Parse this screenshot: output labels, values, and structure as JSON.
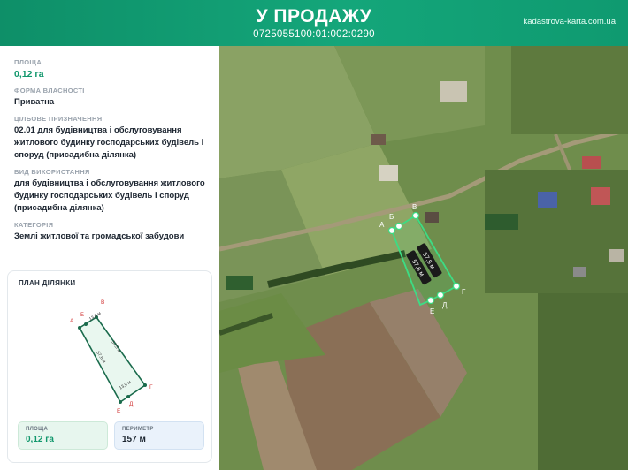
{
  "header": {
    "title": "У ПРОДАЖУ",
    "cadastral_number": "0725055100:01:002:0290",
    "site": "kadastrova-karta.com.ua"
  },
  "info": {
    "area": {
      "label": "ПЛОЩА",
      "value": "0,12 га"
    },
    "ownership": {
      "label": "ФОРМА ВЛАСНОСТІ",
      "value": "Приватна"
    },
    "purpose": {
      "label": "ЦІЛЬОВЕ ПРИЗНАЧЕННЯ",
      "value": "02.01 для будівництва і обслуговування житлового будинку господарських будівель і споруд (присадибна ділянка)"
    },
    "usage": {
      "label": "ВИД ВИКОРИСТАННЯ",
      "value": "для будівництва і обслуговування житлового будинку господарських будівель і споруд (присадибна ділянка)"
    },
    "category": {
      "label": "КАТЕГОРІЯ",
      "value": "Землі житлової та громадської забудови"
    }
  },
  "plan": {
    "title": "ПЛАН ДІЛЯНКИ",
    "vertices": [
      "А",
      "Б",
      "В",
      "Г",
      "Д",
      "Е"
    ],
    "dimensions": {
      "top": "13,8 м",
      "right": "57,5 м",
      "left": "57,6 м",
      "bottom": "13,9 м"
    },
    "area_stat": {
      "label": "ПЛОЩА",
      "value": "0,12 га"
    },
    "perimeter_stat": {
      "label": "ПЕРИМЕТР",
      "value": "157 м"
    }
  },
  "map": {
    "vertices": [
      "А",
      "Б",
      "В",
      "Г",
      "Д",
      "Е"
    ],
    "dim_labels": [
      "57,5 м",
      "57,6 м"
    ]
  },
  "colors": {
    "brand": "#11976c",
    "parcel": "#3ddc84"
  }
}
